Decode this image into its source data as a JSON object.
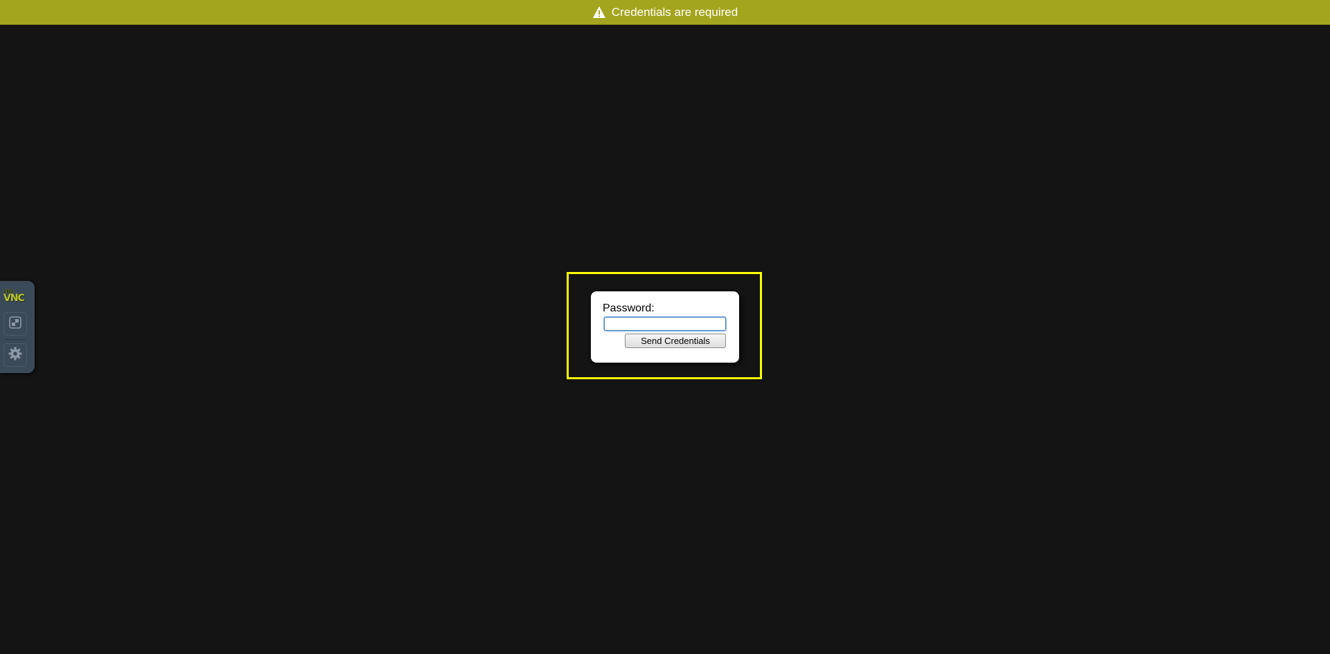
{
  "status": {
    "message": "Credentials are required",
    "icon": "warning-icon",
    "color": "#a4a51e"
  },
  "control_bar": {
    "logo_top": "no",
    "logo_bottom": "VNC",
    "buttons": [
      {
        "name": "extra-keys",
        "icon": "toggle-extra-keys-icon"
      },
      {
        "name": "settings",
        "icon": "gear-icon"
      }
    ]
  },
  "credentials": {
    "password_label": "Password:",
    "password_value": "",
    "send_label": "Send Credentials",
    "highlight_color": "#ffff00"
  }
}
